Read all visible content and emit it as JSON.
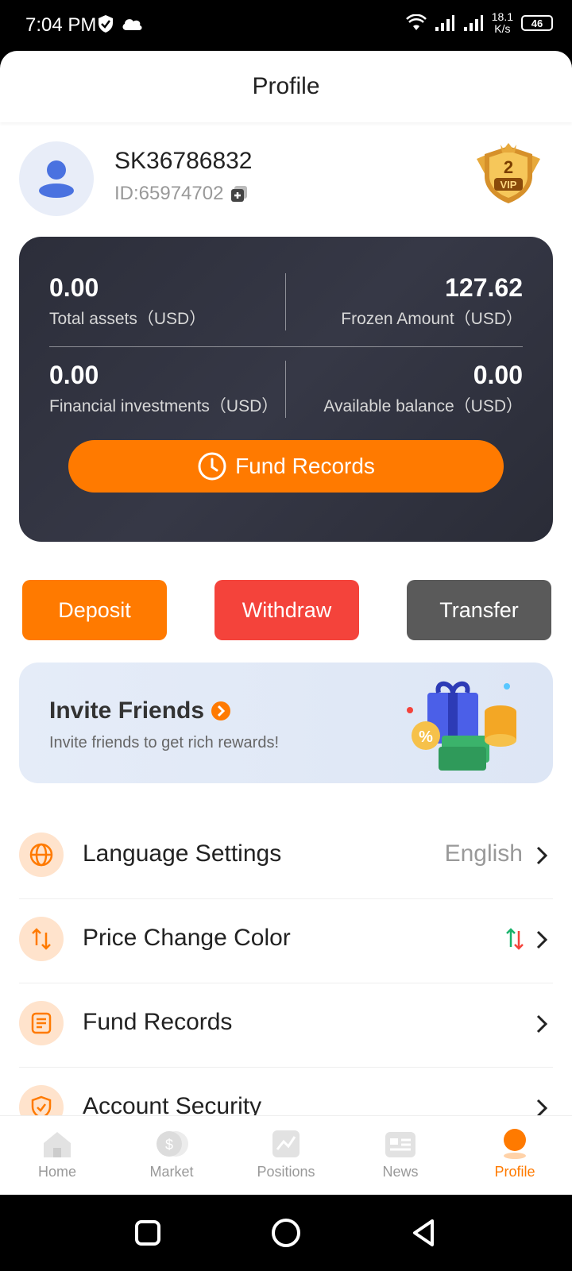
{
  "status": {
    "time": "7:04 PM",
    "speed_value": "18.1",
    "speed_unit": "K/s",
    "battery": "46"
  },
  "header": {
    "title": "Profile"
  },
  "user": {
    "name": "SK36786832",
    "id": "ID:65974702",
    "vip_level": "2",
    "vip_text": "VIP"
  },
  "assets": {
    "total_value": "0.00",
    "total_label": "Total assets（USD）",
    "frozen_value": "127.62",
    "frozen_label": "Frozen Amount（USD）",
    "financial_value": "0.00",
    "financial_label": "Financial investments（USD）",
    "available_value": "0.00",
    "available_label": "Available balance（USD）",
    "fund_records_button": "Fund Records"
  },
  "actions": {
    "deposit": "Deposit",
    "withdraw": "Withdraw",
    "transfer": "Transfer"
  },
  "invite": {
    "title": "Invite Friends",
    "subtitle": "Invite friends to get rich rewards!"
  },
  "menu": [
    {
      "label": "Language Settings",
      "value": "English",
      "icon": "globe-icon"
    },
    {
      "label": "Price Change Color",
      "value": "",
      "icon": "swap-icon"
    },
    {
      "label": "Fund Records",
      "value": "",
      "icon": "document-icon"
    },
    {
      "label": "Account Security",
      "value": "",
      "icon": "shield-icon"
    }
  ],
  "tabs": [
    {
      "label": "Home",
      "icon": "home-icon"
    },
    {
      "label": "Market",
      "icon": "market-icon"
    },
    {
      "label": "Positions",
      "icon": "positions-icon"
    },
    {
      "label": "News",
      "icon": "news-icon"
    },
    {
      "label": "Profile",
      "icon": "profile-icon",
      "active": true
    }
  ],
  "colors": {
    "accent": "#ff7a00",
    "withdraw": "#f4433b",
    "transfer": "#5a5a5a",
    "card": "#2f313d"
  }
}
